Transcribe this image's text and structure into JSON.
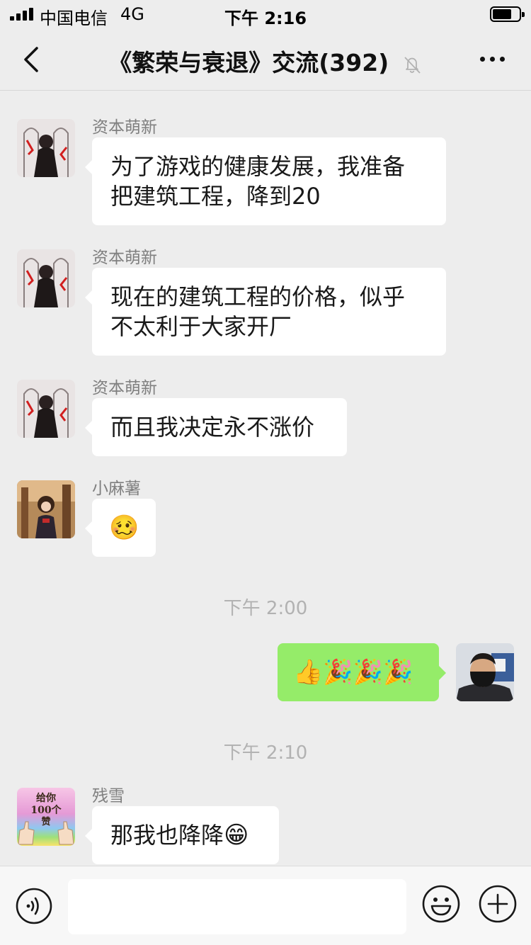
{
  "status_bar": {
    "carrier": "中国电信",
    "network": "4G",
    "time": "下午 2:16"
  },
  "nav": {
    "title": "《繁荣与衰退》交流(392)",
    "back_icon": "chevron-left-icon",
    "mute_icon": "bell-off-icon",
    "more_icon": "ellipsis-icon"
  },
  "messages": [
    {
      "sender": "资本萌新",
      "lines": [
        "为了游戏的健康发展，我准备",
        "把建筑工程，降到20"
      ]
    },
    {
      "sender": "资本萌新",
      "lines": [
        "现在的建筑工程的价格，似乎",
        "不太利于大家开厂"
      ]
    },
    {
      "sender": "资本萌新",
      "lines": [
        "而且我决定永不涨价"
      ]
    },
    {
      "sender": "小麻薯",
      "emoji": "🥴"
    },
    {
      "sender": "me",
      "emojis": [
        "👍",
        "🎉",
        "🎉",
        "🎉"
      ]
    },
    {
      "sender": "残雪",
      "text": "那我也降降",
      "emoji": "😁",
      "avatar_text": [
        "给你",
        "100个",
        "赞"
      ]
    }
  ],
  "timestamps": [
    "下午 2:00",
    "下午 2:10"
  ],
  "input_bar": {
    "placeholder": "",
    "voice_icon": "voice-icon",
    "emoji_icon": "smiley-icon",
    "plus_icon": "plus-icon"
  },
  "colors": {
    "background": "#ededed",
    "bubble_other": "#ffffff",
    "bubble_self": "#95ec69",
    "sender_name": "#7f7f7f",
    "timestamp": "#b2b2b2"
  }
}
